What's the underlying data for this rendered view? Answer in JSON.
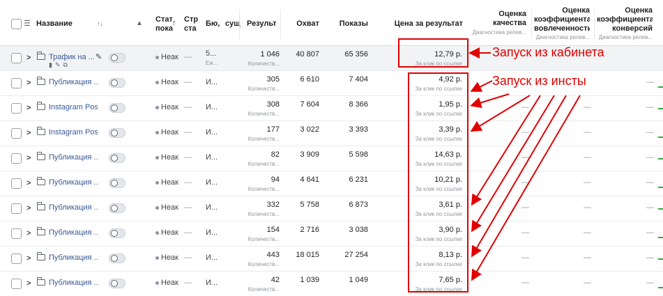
{
  "header": {
    "name_label": "Название",
    "sort_glyph": "↑↓",
    "warning_glyph": "▲",
    "status_label_1": "Стат",
    "status_label_2": "пока",
    "status_arrow": "↑",
    "strategy_label_1": "Стр",
    "strategy_label_2": "ста",
    "budget_label": "Бю,",
    "su_label": "сущ",
    "results_label": "Результ",
    "reach_label": "Охват",
    "impressions_label": "Показы",
    "cpr_label": "Цена за результат",
    "quality_label_1": "Оценка",
    "quality_label_2": "качества",
    "quality_sub": "Диагностика релев...",
    "engagement_label_1": "Оценка",
    "engagement_label_2": "коэффициента",
    "engagement_label_3": "вовлеченности",
    "engagement_sub": "Диагностика релев...",
    "conversion_label_1": "Оценка",
    "conversion_label_2": "коэффициента",
    "conversion_label_3": "конверсий",
    "conversion_sub": "Диагностика релев..."
  },
  "rows": [
    {
      "name": "Трафик на ...",
      "status": "Неак",
      "strategy": "—",
      "budget": "5...",
      "budget_sub": "Еж...",
      "results": "1 046",
      "results_sub": "Количеств...",
      "reach": "40 807",
      "impressions": "65 356",
      "cpr": "12,79 р.",
      "cpr_sub": "За клик по ссылке",
      "q": "",
      "e": "",
      "c": ""
    },
    {
      "name": "Публикация ...",
      "status": "Неак",
      "strategy": "—",
      "budget": "И...",
      "budget_sub": "",
      "results": "305",
      "results_sub": "Количеств...",
      "reach": "6 610",
      "impressions": "7 404",
      "cpr": "4,92 р.",
      "cpr_sub": "За клик по ссылке",
      "q": "",
      "e": "",
      "c": "—"
    },
    {
      "name": "Instagram Post",
      "status": "Неак",
      "strategy": "—",
      "budget": "И...",
      "budget_sub": "",
      "results": "308",
      "results_sub": "Количеств...",
      "reach": "7 604",
      "impressions": "8 366",
      "cpr": "1,95 р.",
      "cpr_sub": "За клик по ссылке",
      "q": "—",
      "e": "—",
      "c": "—"
    },
    {
      "name": "Instagram Post",
      "status": "Неак",
      "strategy": "—",
      "budget": "И...",
      "budget_sub": "",
      "results": "177",
      "results_sub": "Количеств...",
      "reach": "3 022",
      "impressions": "3 393",
      "cpr": "3,39 р.",
      "cpr_sub": "За клик по ссылке",
      "q": "—",
      "e": "—",
      "c": "—"
    },
    {
      "name": "Публикация ...",
      "status": "Неак",
      "strategy": "—",
      "budget": "И...",
      "budget_sub": "",
      "results": "82",
      "results_sub": "Количеств...",
      "reach": "3 909",
      "impressions": "5 598",
      "cpr": "14,63 р.",
      "cpr_sub": "За клик по ссылке",
      "q": "—",
      "e": "—",
      "c": "—"
    },
    {
      "name": "Публикация ...",
      "status": "Неак",
      "strategy": "—",
      "budget": "И...",
      "budget_sub": "",
      "results": "94",
      "results_sub": "Количеств...",
      "reach": "4 641",
      "impressions": "6 231",
      "cpr": "10,21 р.",
      "cpr_sub": "За клик по ссылке",
      "q": "—",
      "e": "—",
      "c": "—"
    },
    {
      "name": "Публикация ...",
      "status": "Неак",
      "strategy": "—",
      "budget": "И...",
      "budget_sub": "",
      "results": "332",
      "results_sub": "Количеств...",
      "reach": "5 758",
      "impressions": "6 873",
      "cpr": "3,61 р.",
      "cpr_sub": "За клик по ссылке",
      "q": "—",
      "e": "—",
      "c": "—"
    },
    {
      "name": "Публикация ...",
      "status": "Неак",
      "strategy": "—",
      "budget": "И...",
      "budget_sub": "",
      "results": "154",
      "results_sub": "Количеств...",
      "reach": "2 716",
      "impressions": "3 038",
      "cpr": "3,90 р.",
      "cpr_sub": "За клик по ссылке",
      "q": "—",
      "e": "—",
      "c": "—"
    },
    {
      "name": "Публикация ...",
      "status": "Неак",
      "strategy": "—",
      "budget": "И...",
      "budget_sub": "",
      "results": "443",
      "results_sub": "Количеств...",
      "reach": "18 015",
      "impressions": "27 254",
      "cpr": "8,13 р.",
      "cpr_sub": "За клик по ссылке",
      "q": "—",
      "e": "—",
      "c": "—"
    },
    {
      "name": "Публикация ...",
      "status": "Неак",
      "strategy": "—",
      "budget": "И...",
      "budget_sub": "",
      "results": "42",
      "results_sub": "Количеств...",
      "reach": "1 039",
      "impressions": "1 049",
      "cpr": "7,65 р.",
      "cpr_sub": "За клик по ссылке",
      "q": "—",
      "e": "—",
      "c": "—"
    }
  ],
  "annotations": {
    "cabinet": "Запуск из кабинета",
    "insta": "Запуск из инсты",
    "color": "#e00000"
  },
  "icons": {
    "chevron": "chevron-right-icon",
    "folder": "folder-icon",
    "pencil": "pencil-icon",
    "toggle": "toggle-switch"
  }
}
